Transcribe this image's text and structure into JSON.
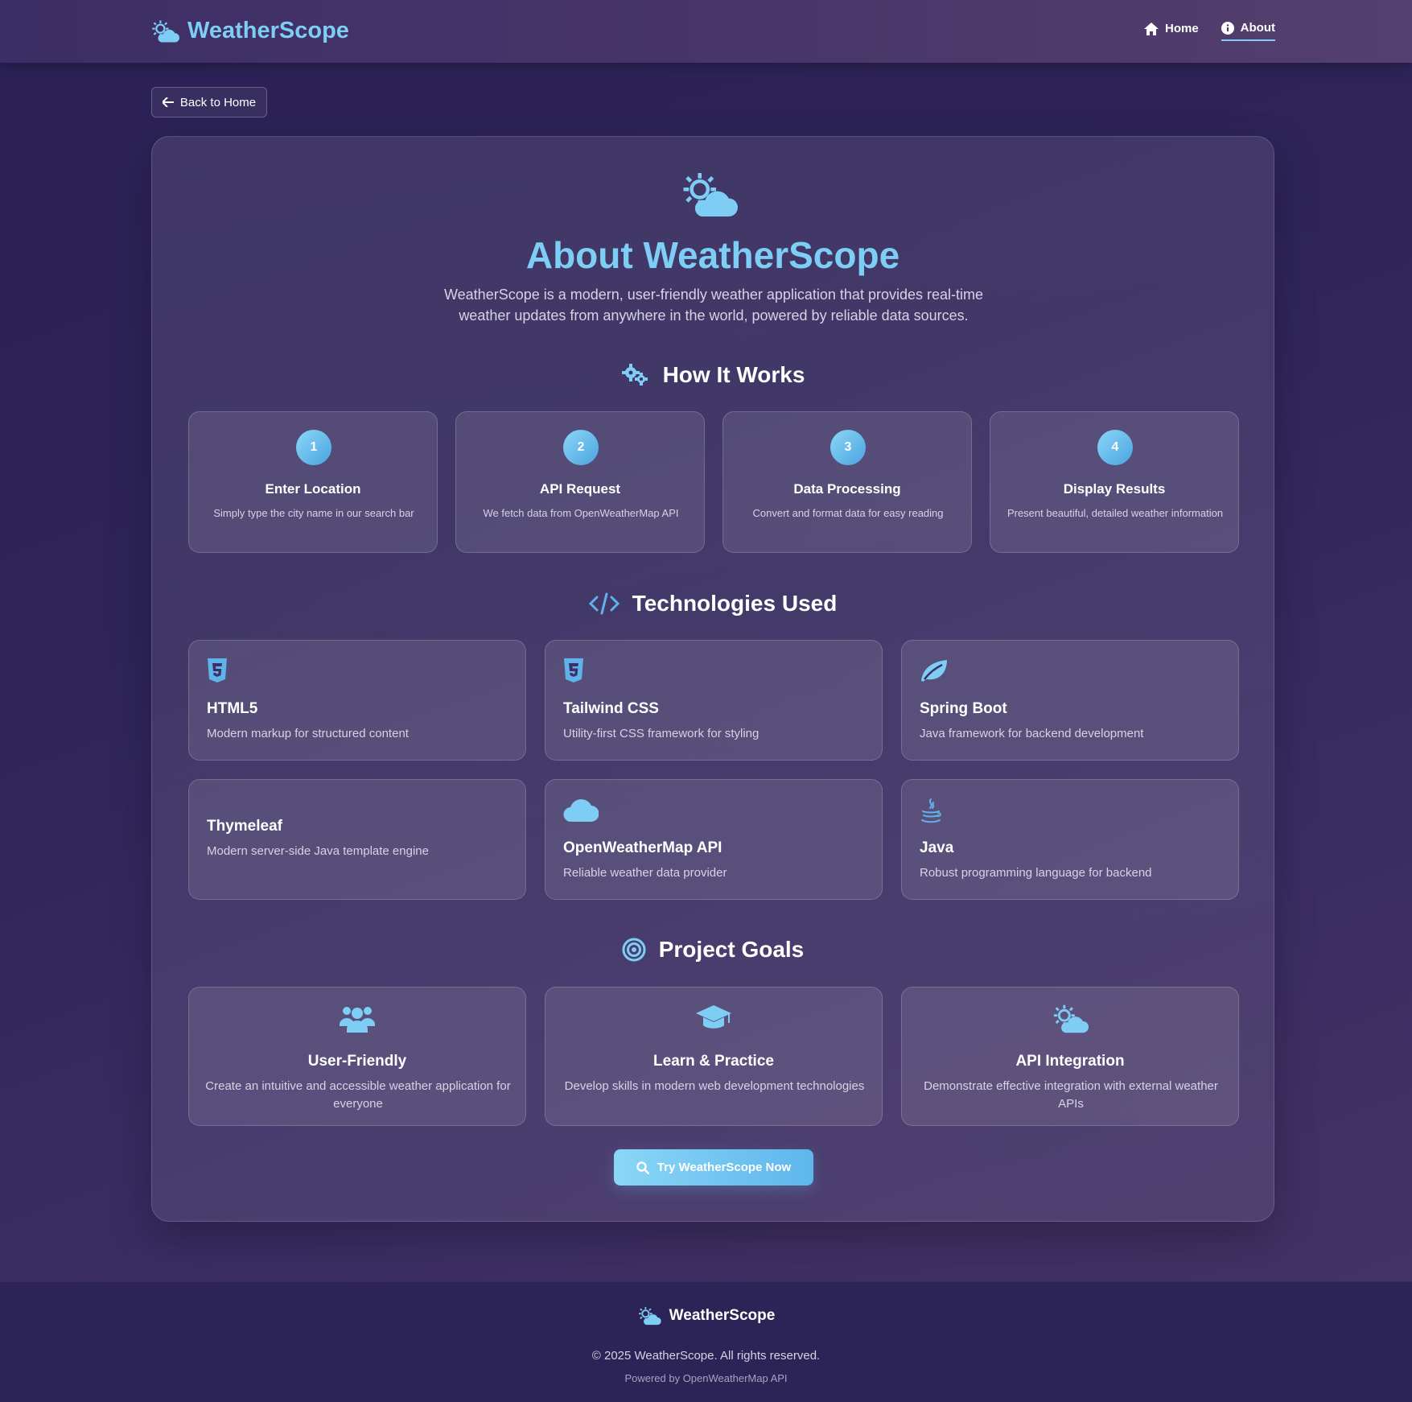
{
  "nav": {
    "brand": "WeatherScope",
    "links": [
      {
        "label": "Home",
        "icon": "home-icon"
      },
      {
        "label": "About",
        "icon": "info-icon",
        "active": true
      }
    ]
  },
  "back_button": {
    "label": "Back to Home",
    "icon": "arrow-left-icon"
  },
  "hero": {
    "icon": "sun-cloud-icon",
    "title": "About WeatherScope",
    "intro": "WeatherScope is a modern, user-friendly weather application that provides real-time weather updates from anywhere in the world, powered by reliable data sources."
  },
  "how_it_works": {
    "title": "How It Works",
    "icon": "gears-icon",
    "steps": [
      {
        "number": "1",
        "title": "Enter Location",
        "desc": "Simply type the city name in our search bar"
      },
      {
        "number": "2",
        "title": "API Request",
        "desc": "We fetch data from OpenWeatherMap API"
      },
      {
        "number": "3",
        "title": "Data Processing",
        "desc": "Convert and format data for easy reading"
      },
      {
        "number": "4",
        "title": "Display Results",
        "desc": "Present beautiful, detailed weather information"
      }
    ]
  },
  "technologies": {
    "title": "Technologies Used",
    "icon": "code-icon",
    "items": [
      {
        "icon": "html5-icon",
        "title": "HTML5",
        "desc": "Modern markup for structured content"
      },
      {
        "icon": "css3-icon",
        "title": "Tailwind CSS",
        "desc": "Utility-first CSS framework for styling"
      },
      {
        "icon": "leaf-icon",
        "title": "Spring Boot",
        "desc": "Java framework for backend development"
      },
      {
        "icon": "",
        "title": "Thymeleaf",
        "desc": "Modern server-side Java template engine"
      },
      {
        "icon": "cloud-icon",
        "title": "OpenWeatherMap API",
        "desc": "Reliable weather data provider"
      },
      {
        "icon": "java-icon",
        "title": "Java",
        "desc": "Robust programming language for backend"
      }
    ]
  },
  "goals": {
    "title": "Project Goals",
    "icon": "target-icon",
    "items": [
      {
        "icon": "users-icon",
        "title": "User-Friendly",
        "desc": "Create an intuitive and accessible weather application for everyone"
      },
      {
        "icon": "graduation-cap-icon",
        "title": "Learn & Practice",
        "desc": "Develop skills in modern web development technologies"
      },
      {
        "icon": "sun-cloud-icon",
        "title": "API Integration",
        "desc": "Demonstrate effective integration with external weather APIs"
      }
    ]
  },
  "cta": {
    "label": "Try WeatherScope Now",
    "icon": "search-icon"
  },
  "footer": {
    "brand": "WeatherScope",
    "copyright": "© 2025 WeatherScope. All rights reserved.",
    "powered": "Powered by OpenWeatherMap API"
  },
  "colors": {
    "accent": "#7dcdf5",
    "accent_dark": "#4ba4e0"
  }
}
